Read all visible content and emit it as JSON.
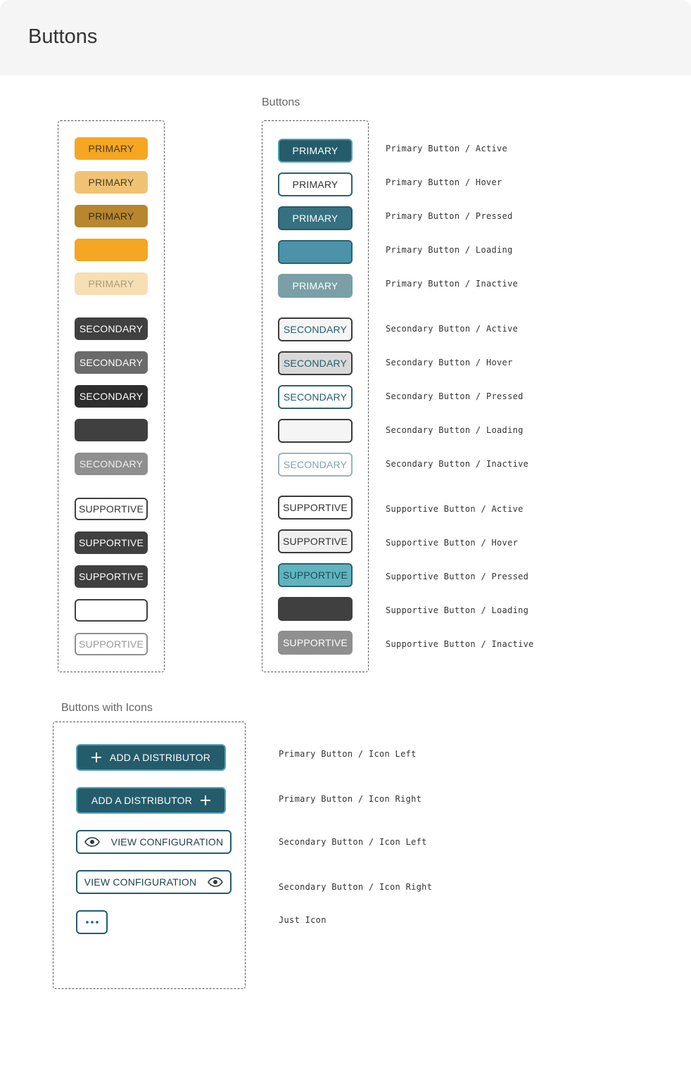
{
  "page": {
    "title": "Buttons"
  },
  "sections": {
    "buttons_label": "Buttons",
    "icons_label": "Buttons with Icons"
  },
  "left_column": {
    "primary": [
      {
        "label": "PRIMARY",
        "state": "active",
        "bg": "#f5a623",
        "color": "#4a3a1a"
      },
      {
        "label": "PRIMARY",
        "state": "hover",
        "bg": "#f0c374",
        "color": "#4a3a1a"
      },
      {
        "label": "PRIMARY",
        "state": "pressed",
        "bg": "#b8862f",
        "color": "#3a2c12"
      },
      {
        "label": "",
        "state": "loading",
        "bg": "#f5a623",
        "color": "#4a3a1a"
      },
      {
        "label": "PRIMARY",
        "state": "inactive",
        "bg": "#f7dfb3",
        "color": "#a89a80"
      }
    ],
    "secondary": [
      {
        "label": "SECONDARY",
        "state": "active",
        "bg": "#404040",
        "color": "#ffffff"
      },
      {
        "label": "SECONDARY",
        "state": "hover",
        "bg": "#6b6b6b",
        "color": "#ffffff"
      },
      {
        "label": "SECONDARY",
        "state": "pressed",
        "bg": "#2e2e2e",
        "color": "#ffffff"
      },
      {
        "label": "",
        "state": "loading",
        "bg": "#404040",
        "color": "#ffffff"
      },
      {
        "label": "SECONDARY",
        "state": "inactive",
        "bg": "#8f8f8f",
        "color": "#f0f0f0"
      }
    ],
    "supportive": [
      {
        "label": "SUPPORTIVE",
        "state": "active",
        "bg": "#ffffff",
        "color": "#333333",
        "border": "#404040"
      },
      {
        "label": "SUPPORTIVE",
        "state": "hover",
        "bg": "#404040",
        "color": "#ffffff",
        "border": "#404040"
      },
      {
        "label": "SUPPORTIVE",
        "state": "pressed",
        "bg": "#404040",
        "color": "#ffffff",
        "border": "#404040"
      },
      {
        "label": "",
        "state": "loading",
        "bg": "#ffffff",
        "color": "#333333",
        "border": "#404040"
      },
      {
        "label": "SUPPORTIVE",
        "state": "inactive",
        "bg": "#ffffff",
        "color": "#999999",
        "border": "#8f8f8f"
      }
    ]
  },
  "right_column": {
    "primary": [
      {
        "label": "PRIMARY",
        "bg": "#255c6b",
        "color": "#ffffff",
        "border": "#4fa3b6",
        "desc": "Primary Button / Active"
      },
      {
        "label": "PRIMARY",
        "bg": "#ffffff",
        "color": "#333333",
        "border": "#2c6270",
        "desc": "Primary Button / Hover"
      },
      {
        "label": "PRIMARY",
        "bg": "#357180",
        "color": "#ffffff",
        "border": "#2a5a66",
        "desc": "Primary Button / Pressed"
      },
      {
        "label": "",
        "bg": "#4a93a8",
        "color": "#ffffff",
        "border": "#2c6270",
        "desc": "Primary Button / Loading"
      },
      {
        "label": "PRIMARY",
        "bg": "#7a9fa6",
        "color": "#ffffff",
        "border": "#7a9fa6",
        "desc": "Primary Button / Inactive"
      }
    ],
    "secondary": [
      {
        "label": "SECONDARY",
        "bg": "#f5f5f5",
        "color": "#255c6b",
        "border": "#3a3a3a",
        "desc": "Secondary Button / Active"
      },
      {
        "label": "SECONDARY",
        "bg": "#d9d9d9",
        "color": "#255c6b",
        "border": "#3a3a3a",
        "desc": "Secondary Button / Hover"
      },
      {
        "label": "SECONDARY",
        "bg": "#ffffff",
        "color": "#255c6b",
        "border": "#2c6270",
        "desc": "Secondary Button / Pressed"
      },
      {
        "label": "",
        "bg": "#f5f5f5",
        "color": "#255c6b",
        "border": "#3a3a3a",
        "desc": "Secondary Button / Loading"
      },
      {
        "label": "SECONDARY",
        "bg": "#ffffff",
        "color": "#7fa5ad",
        "border": "#9bb4b9",
        "desc": "Secondary Button / Inactive"
      }
    ],
    "supportive": [
      {
        "label": "SUPPORTIVE",
        "bg": "#ffffff",
        "color": "#333333",
        "border": "#3a3a3a",
        "desc": "Supportive Button / Active"
      },
      {
        "label": "SUPPORTIVE",
        "bg": "#f0f0f0",
        "color": "#333333",
        "border": "#3a3a3a",
        "desc": "Supportive Button / Hover"
      },
      {
        "label": "SUPPORTIVE",
        "bg": "#5fb4bf",
        "color": "#1f4a52",
        "border": "#2c6270",
        "desc": "Supportive Button / Pressed"
      },
      {
        "label": "",
        "bg": "#404040",
        "color": "#ffffff",
        "border": "#404040",
        "desc": "Supportive Button / Loading"
      },
      {
        "label": "SUPPORTIVE",
        "bg": "#8f8f8f",
        "color": "#ffffff",
        "border": "#8f8f8f",
        "desc": "Supportive Button / Inactive"
      }
    ]
  },
  "icon_buttons": {
    "add_left": {
      "label": "ADD A DISTRIBUTOR",
      "icon": "plus-icon",
      "desc": "Primary Button / Icon Left"
    },
    "add_right": {
      "label": "ADD A DISTRIBUTOR",
      "icon": "plus-icon",
      "desc": "Primary Button / Icon Right"
    },
    "view_left": {
      "label": "VIEW CONFIGURATION",
      "icon": "eye-icon",
      "desc": "Secondary Button / Icon Left"
    },
    "view_right": {
      "label": "VIEW CONFIGURATION",
      "icon": "eye-icon",
      "desc": "Secondary Button / Icon Right"
    },
    "just_icon": {
      "icon": "more-dots-icon",
      "desc": "Just Icon"
    }
  },
  "colors": {
    "teal_dark": "#255c6b",
    "teal_border": "#4fa3b6",
    "amber": "#f5a623"
  }
}
